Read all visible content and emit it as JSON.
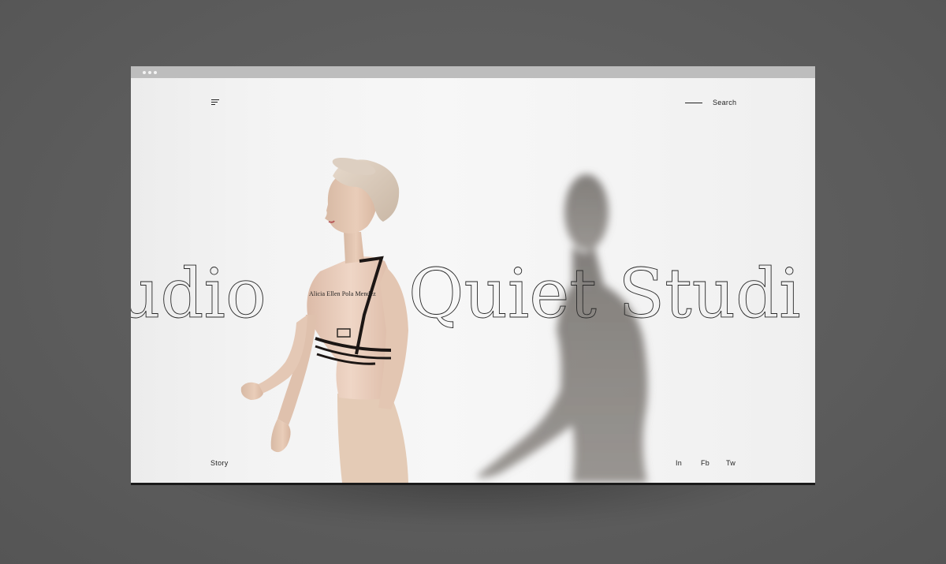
{
  "window": {
    "controls": [
      "dot",
      "dot",
      "dot"
    ]
  },
  "header": {
    "menu_icon": "menu-icon",
    "search_label": "Search"
  },
  "hero": {
    "title_left": "udio",
    "title_right": "Quiet Studi",
    "caption": "Alicia Ellen Pola Mendez",
    "image": "woman-in-beige-with-harness-and-shadow"
  },
  "footer": {
    "story_label": "Story",
    "social": [
      "In",
      "Fb",
      "Tw"
    ]
  },
  "colors": {
    "background": "#5f5f5f",
    "page": "#f3f3f3",
    "text": "#1f1f1f",
    "chrome": "#bdbdbd",
    "accent_bar": "#1a1a1a"
  }
}
